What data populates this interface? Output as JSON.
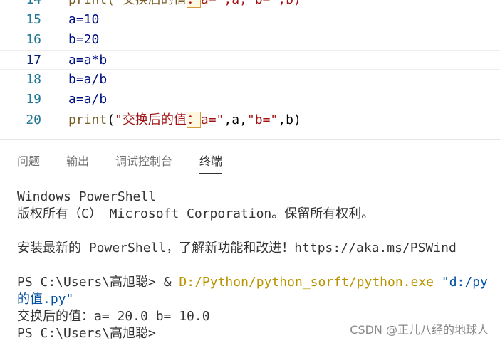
{
  "editor": {
    "lines": [
      {
        "num": "14",
        "before": "print(\"交换后的值",
        "hl": "：",
        "after": "a=\",a,\"b=\",b)"
      },
      {
        "num": "15",
        "text": "a=10"
      },
      {
        "num": "16",
        "text": "b=20"
      },
      {
        "num": "17",
        "text": "a=a*b"
      },
      {
        "num": "18",
        "text": "b=a/b"
      },
      {
        "num": "19",
        "text": "a=a/b"
      },
      {
        "num": "20",
        "fn": "print",
        "open": "(",
        "str1": "\"交换后的值",
        "hl": "：",
        "str2": "a=\"",
        "mid1": ",a,",
        "str3": "\"b=\"",
        "mid2": ",b)"
      }
    ]
  },
  "panel": {
    "tabs": [
      "问题",
      "输出",
      "调试控制台",
      "终端"
    ]
  },
  "terminal": {
    "line1": "Windows PowerShell",
    "line2": "版权所有（C） Microsoft Corporation。保留所有权利。",
    "line3": "安装最新的 PowerShell，了解新功能和改进！https://aka.ms/PSWind",
    "prompt1": "PS C:\\Users\\高旭聪> & ",
    "exe": "D:/Python/python_sorft/python.exe",
    "arg": "\"d:/py",
    "arg_cont": "的值.py\"",
    "output": "交换后的值：a= 20.0 b= 10.0",
    "prompt2": "PS C:\\Users\\高旭聪>"
  },
  "watermark": "CSDN @正儿八经的地球人"
}
